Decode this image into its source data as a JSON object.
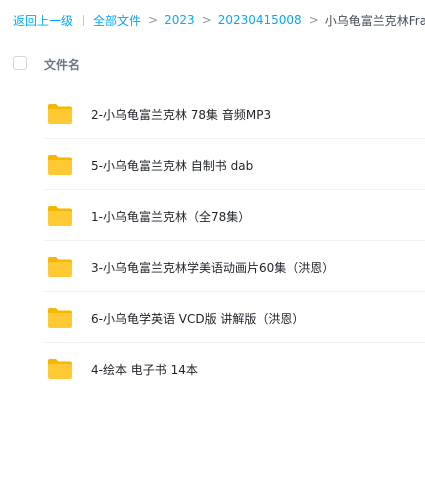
{
  "breadcrumb": {
    "back": "返回上一级",
    "all_files": "全部文件",
    "level1": "2023",
    "level2": "20230415008",
    "current": "小乌龟富兰克林Fran"
  },
  "table": {
    "header_name": "文件名"
  },
  "files": [
    {
      "name": "2-小乌龟富兰克林 78集 音频MP3",
      "icon": "folder-icon"
    },
    {
      "name": "5-小乌龟富兰克林 自制书 dab",
      "icon": "folder-icon"
    },
    {
      "name": "1-小乌龟富兰克林（全78集）",
      "icon": "folder-icon"
    },
    {
      "name": "3-小乌龟富兰克林学美语动画片60集（洪恩）",
      "icon": "folder-icon"
    },
    {
      "name": "6-小乌龟学英语 VCD版 讲解版（洪恩）",
      "icon": "folder-icon"
    },
    {
      "name": "4-绘本 电子书 14本",
      "icon": "folder-icon"
    }
  ],
  "colors": {
    "link": "#06a7ff",
    "folder_back": "#f5b700",
    "folder_front": "#ffc933"
  }
}
